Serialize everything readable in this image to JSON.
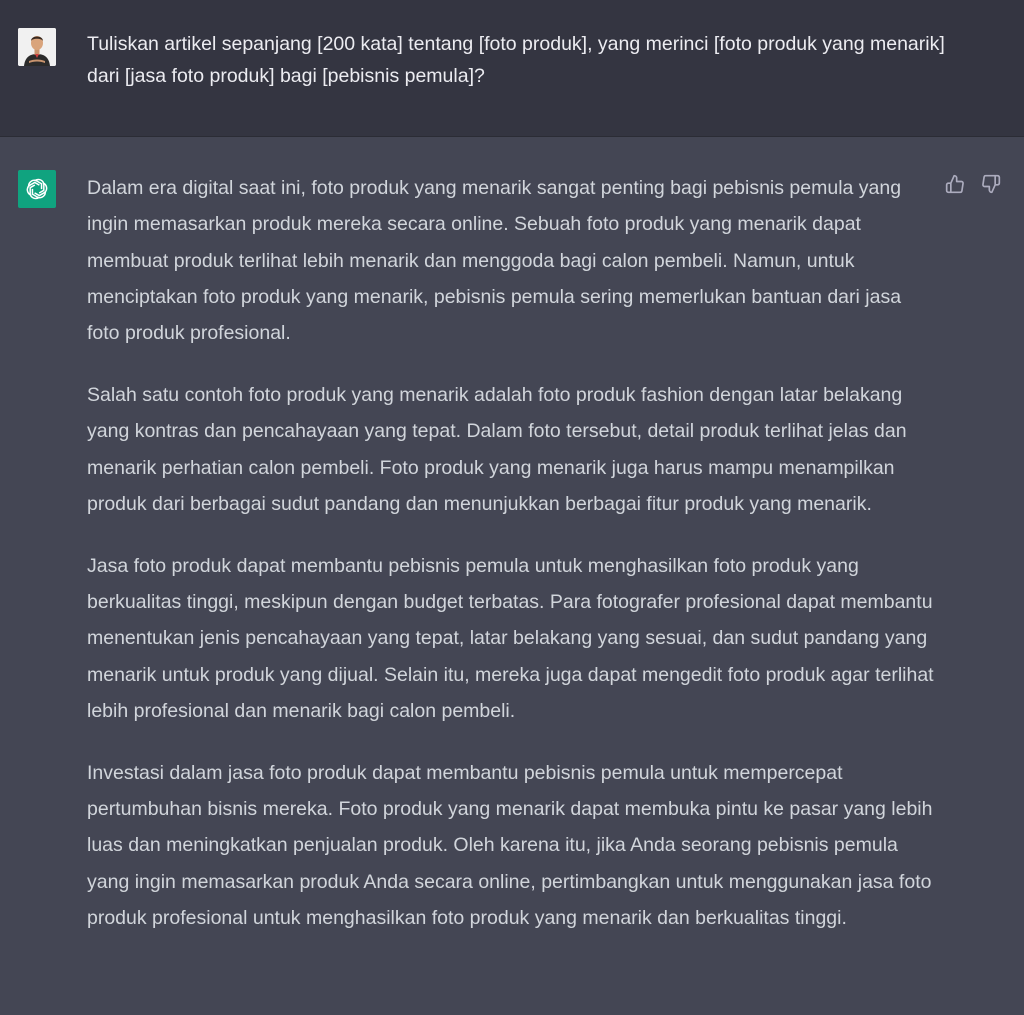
{
  "user_message": {
    "text": "Tuliskan artikel sepanjang [200 kata] tentang [foto produk], yang merinci [foto produk yang menarik] dari [jasa foto produk] bagi [pebisnis pemula]?"
  },
  "assistant_message": {
    "paragraphs": [
      "Dalam era digital saat ini, foto produk yang menarik sangat penting bagi pebisnis pemula yang ingin memasarkan produk mereka secara online. Sebuah foto produk yang menarik dapat membuat produk terlihat lebih menarik dan menggoda bagi calon pembeli. Namun, untuk menciptakan foto produk yang menarik, pebisnis pemula sering memerlukan bantuan dari jasa foto produk profesional.",
      "Salah satu contoh foto produk yang menarik adalah foto produk fashion dengan latar belakang yang kontras dan pencahayaan yang tepat. Dalam foto tersebut, detail produk terlihat jelas dan menarik perhatian calon pembeli. Foto produk yang menarik juga harus mampu menampilkan produk dari berbagai sudut pandang dan menunjukkan berbagai fitur produk yang menarik.",
      "Jasa foto produk dapat membantu pebisnis pemula untuk menghasilkan foto produk yang berkualitas tinggi, meskipun dengan budget terbatas. Para fotografer profesional dapat membantu menentukan jenis pencahayaan yang tepat, latar belakang yang sesuai, dan sudut pandang yang menarik untuk produk yang dijual. Selain itu, mereka juga dapat mengedit foto produk agar terlihat lebih profesional dan menarik bagi calon pembeli.",
      "Investasi dalam jasa foto produk dapat membantu pebisnis pemula untuk mempercepat pertumbuhan bisnis mereka. Foto produk yang menarik dapat membuka pintu ke pasar yang lebih luas dan meningkatkan penjualan produk. Oleh karena itu, jika Anda seorang pebisnis pemula yang ingin memasarkan produk Anda secara online, pertimbangkan untuk menggunakan jasa foto produk profesional untuk menghasilkan foto produk yang menarik dan berkualitas tinggi."
    ]
  },
  "icons": {
    "user_avatar": "user-avatar-icon",
    "assistant_avatar": "openai-logo-icon",
    "thumbs_up": "thumbs-up-icon",
    "thumbs_down": "thumbs-down-icon"
  },
  "colors": {
    "user_bg": "#343541",
    "assistant_bg": "#444654",
    "brand": "#10a37f",
    "text": "#d1d5db"
  }
}
